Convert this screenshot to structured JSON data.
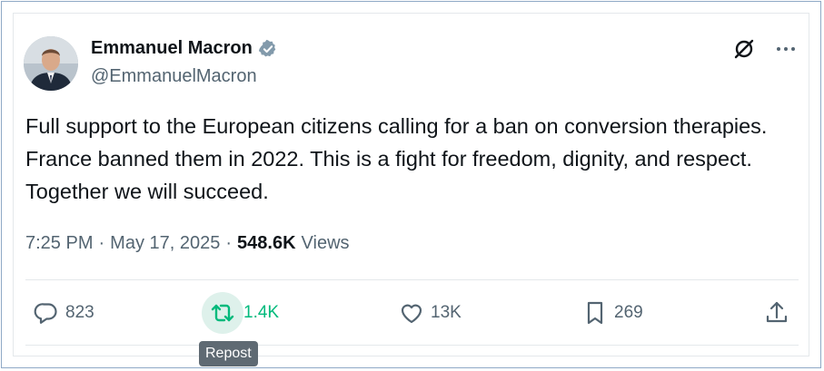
{
  "author": {
    "name": "Emmanuel Macron",
    "handle": "@EmmanuelMacron",
    "verified_icon": "verified-badge-icon"
  },
  "tweet": {
    "text": "Full support to the European citizens calling for a ban on conversion therapies. France banned them in 2022. This is a fight for freedom, dignity, and respect. Together we will succeed."
  },
  "meta": {
    "time": "7:25 PM",
    "separator1": "·",
    "date": "May 17, 2025",
    "separator2": "·",
    "views_count": "548.6K",
    "views_label": "Views"
  },
  "actions": {
    "reply_count": "823",
    "repost_count": "1.4K",
    "like_count": "13K",
    "bookmark_count": "269"
  },
  "tooltip": {
    "text": "Repost"
  },
  "colors": {
    "text_primary": "#0f1419",
    "text_secondary": "#536471",
    "repost_green": "#00ba7c",
    "verified_gray": "#829aab"
  }
}
